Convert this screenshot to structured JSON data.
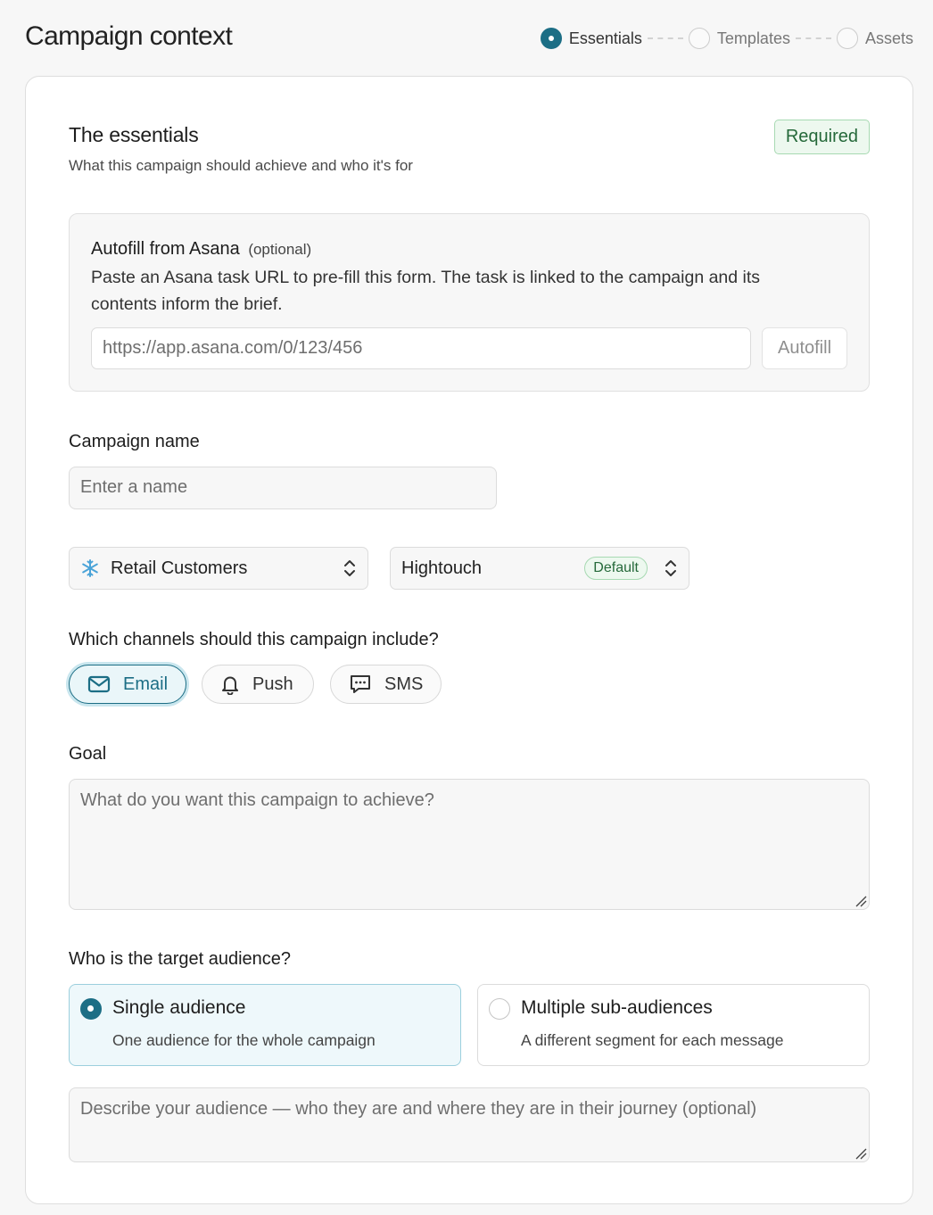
{
  "header": {
    "title": "Campaign context",
    "steps": [
      {
        "label": "Essentials",
        "active": true
      },
      {
        "label": "Templates",
        "active": false
      },
      {
        "label": "Assets",
        "active": false
      }
    ]
  },
  "section": {
    "title": "The essentials",
    "subtitle": "What this campaign should achieve and who it's for",
    "badge": "Required"
  },
  "autofill": {
    "title": "Autofill from Asana",
    "optional": "(optional)",
    "description": "Paste an Asana task URL to pre-fill this form. The task is linked to the campaign and its contents inform the brief.",
    "placeholder": "https://app.asana.com/0/123/456",
    "button": "Autofill"
  },
  "campaign_name": {
    "label": "Campaign name",
    "placeholder": "Enter a name"
  },
  "selects": {
    "audience_source": {
      "value": "Retail Customers",
      "icon": "snowflake-icon"
    },
    "platform": {
      "value": "Hightouch",
      "badge": "Default"
    }
  },
  "channels": {
    "label": "Which channels should this campaign include?",
    "items": [
      {
        "label": "Email",
        "icon": "mail-icon",
        "selected": true
      },
      {
        "label": "Push",
        "icon": "bell-icon",
        "selected": false
      },
      {
        "label": "SMS",
        "icon": "message-icon",
        "selected": false
      }
    ]
  },
  "goal": {
    "label": "Goal",
    "placeholder": "What do you want this campaign to achieve?"
  },
  "audience": {
    "label": "Who is the target audience?",
    "options": [
      {
        "title": "Single audience",
        "description": "One audience for the whole campaign",
        "selected": true
      },
      {
        "title": "Multiple sub-audiences",
        "description": "A different segment for each message",
        "selected": false
      }
    ],
    "placeholder": "Describe your audience — who they are and where they are in their journey (optional)"
  },
  "colors": {
    "accent": "#1c6e85",
    "success_bg": "#edf8ef",
    "success_text": "#25693a"
  }
}
